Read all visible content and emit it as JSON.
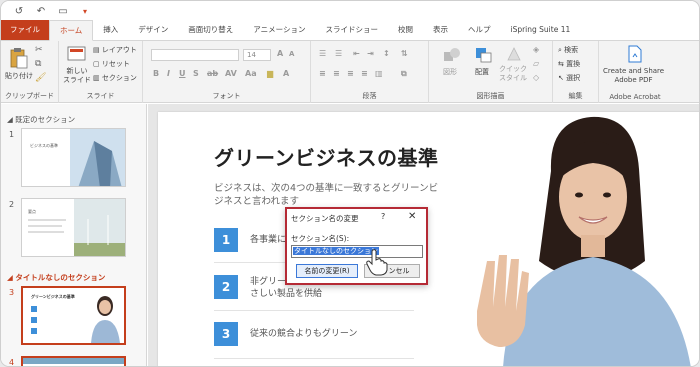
{
  "quick_access": {
    "icons": [
      "autosave-icon",
      "undo-icon",
      "start-presentation-icon",
      "customize-icon"
    ]
  },
  "tabs": [
    {
      "label": "ファイル"
    },
    {
      "label": "ホーム"
    },
    {
      "label": "挿入"
    },
    {
      "label": "デザイン"
    },
    {
      "label": "画面切り替え"
    },
    {
      "label": "アニメーション"
    },
    {
      "label": "スライドショー"
    },
    {
      "label": "校閲"
    },
    {
      "label": "表示"
    },
    {
      "label": "ヘルプ"
    },
    {
      "label": "iSpring Suite 11"
    }
  ],
  "ribbon": {
    "clipboard": {
      "paste": "貼り付け",
      "group": "クリップボード"
    },
    "slides": {
      "new_slide": "新しい\nスライド",
      "layout": "レイアウト",
      "reset": "リセット",
      "section": "セクション",
      "group": "スライド"
    },
    "font": {
      "size": "14",
      "group": "フォント"
    },
    "paragraph": {
      "group": "段落"
    },
    "drawing": {
      "shapes": "図形",
      "arrange": "配置",
      "quick_styles": "クイック\nスタイル",
      "group": "図形描画"
    },
    "editing": {
      "find": "検索",
      "replace": "置換",
      "select": "選択",
      "group": "編集"
    },
    "acrobat": {
      "create": "Create and Share\nAdobe PDF",
      "group": "Adobe Acrobat"
    }
  },
  "slides_panel": {
    "section1": "既定のセクション",
    "section2": "タイトルなしのセクション",
    "slides": [
      {
        "num": "1",
        "title": "ビジネスの基準"
      },
      {
        "num": "2",
        "title": "要点"
      },
      {
        "num": "3",
        "title": "グリーンビジネスの基準"
      },
      {
        "num": "4",
        "title": ""
      }
    ]
  },
  "slide": {
    "title": "グリーンビジネスの基準",
    "subtitle": "ビジネスは、次の4つの基準に一致するとグリーンビジネスと言われます",
    "items": [
      {
        "num": "1",
        "text": "各事業に…"
      },
      {
        "num": "2",
        "text": "非グリーン製品の代わりとなる環境にやさしい製品を供給"
      },
      {
        "num": "3",
        "text": "従来の競合よりもグリーン"
      }
    ]
  },
  "dialog": {
    "title": "セクション名の変更",
    "help": "?",
    "close": "✕",
    "label": "セクション名(S):",
    "value": "タイトルなしのセクション",
    "rename_button": "名前の変更(R)",
    "cancel_button": "キャンセル"
  },
  "colors": {
    "accent": "#c43e1c",
    "dialog_border": "#b52a35",
    "number_box": "#3d8fd9",
    "selection": "#3b78d8"
  }
}
